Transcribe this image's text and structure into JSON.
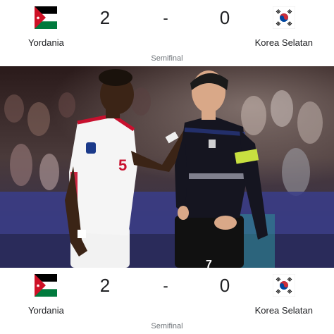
{
  "match_top": {
    "home_team": "Yordania",
    "away_team": "Korea Selatan",
    "home_score": "2",
    "away_score": "0",
    "separator": "-",
    "stage": "Semifinal"
  },
  "match_bottom": {
    "home_team": "Yordania",
    "away_team": "Korea Selatan",
    "home_score": "2",
    "away_score": "0",
    "separator": "-",
    "stage": "Semifinal"
  },
  "photo": {
    "home_shirt_number": "5",
    "away_shirt_number": "7"
  },
  "colors": {
    "jordan_black": "#000000",
    "jordan_green": "#007a3d",
    "jordan_red": "#ce1126",
    "korea_red": "#cd2e3a",
    "korea_blue": "#0047a0"
  }
}
